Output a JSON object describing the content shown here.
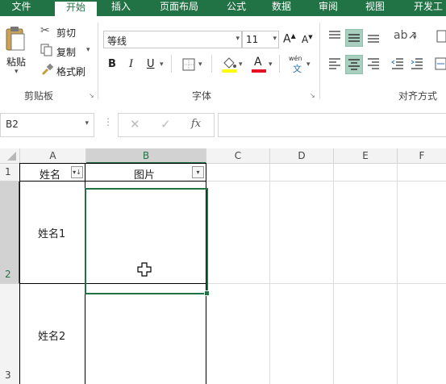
{
  "tabs": [
    "文件",
    "开始",
    "插入",
    "页面布局",
    "公式",
    "数据",
    "审阅",
    "视图",
    "开发工"
  ],
  "clipboard": {
    "paste": "粘贴",
    "cut": "剪切",
    "copy": "复制",
    "format_painter": "格式刷",
    "group": "剪贴板"
  },
  "font": {
    "name": "等线",
    "size": "11",
    "grow": "A",
    "shrink": "A",
    "bold": "B",
    "italic": "I",
    "underline": "U",
    "color_letter": "A",
    "phonetic": "wén",
    "phonetic_char": "文",
    "group": "字体"
  },
  "alignment": {
    "group": "对齐方式"
  },
  "formula_bar": {
    "name_box": "B2",
    "fx": "fx",
    "value": ""
  },
  "columns": [
    "A",
    "B",
    "C",
    "D",
    "E",
    "F"
  ],
  "rows": [
    "1",
    "2",
    "3"
  ],
  "cells": {
    "A1": "姓名",
    "B1": "图片",
    "A2": "姓名1",
    "A3": "姓名2"
  },
  "colors": {
    "accent": "#217346",
    "selection": "#217346",
    "highlight_fill": "#ffff00",
    "font_color": "#e81123"
  }
}
